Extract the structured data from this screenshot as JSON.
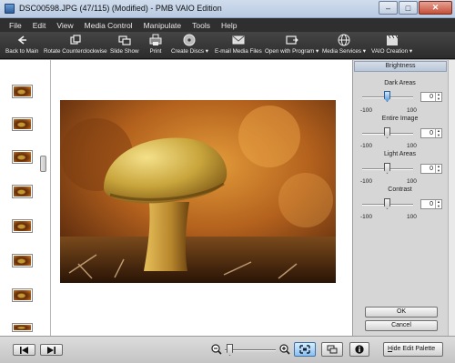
{
  "window": {
    "title": "DSC00598.JPG (47/115) (Modified) - PMB VAIO Edition",
    "minimize": "–",
    "maximize": "□",
    "close": "✕"
  },
  "menu": [
    "File",
    "Edit",
    "View",
    "Media Control",
    "Manipulate",
    "Tools",
    "Help"
  ],
  "toolbar": [
    {
      "label": "Back to Main",
      "icon": "back-arrow-icon"
    },
    {
      "label": "Rotate Counterclockwise",
      "icon": "rotate-ccw-icon"
    },
    {
      "label": "Slide Show",
      "icon": "slideshow-icon"
    },
    {
      "label": "Print",
      "icon": "printer-icon"
    },
    {
      "label": "Create Discs ▾",
      "icon": "disc-icon"
    },
    {
      "label": "E-mail Media Files",
      "icon": "envelope-icon"
    },
    {
      "label": "Open with Program ▾",
      "icon": "open-program-icon"
    },
    {
      "label": "Media Services ▾",
      "icon": "globe-icon"
    },
    {
      "label": "VAIO Creation ▾",
      "icon": "clapperboard-icon"
    }
  ],
  "palette": {
    "header": "Brightness",
    "sliders": [
      {
        "label": "Dark Areas",
        "value": "0",
        "min": "-100",
        "max": "100",
        "level": 0.5
      },
      {
        "label": "Entire Image",
        "value": "0",
        "min": "-100",
        "max": "100",
        "level": 0.5
      },
      {
        "label": "Light Areas",
        "value": "0",
        "min": "-100",
        "max": "100",
        "level": 0.5
      },
      {
        "label": "Contrast",
        "value": "0",
        "min": "-100",
        "max": "100",
        "level": 0.5
      }
    ],
    "ok": "OK",
    "cancel": "Cancel"
  },
  "bottom": {
    "hide_prefix": "H",
    "hide_rest": "ide Edit Palette",
    "zoom_level": 0.05
  },
  "colors": {
    "menubar": "#2f2f2f",
    "toolbar": "#3a3a3a",
    "active": "#8cc0ef"
  }
}
